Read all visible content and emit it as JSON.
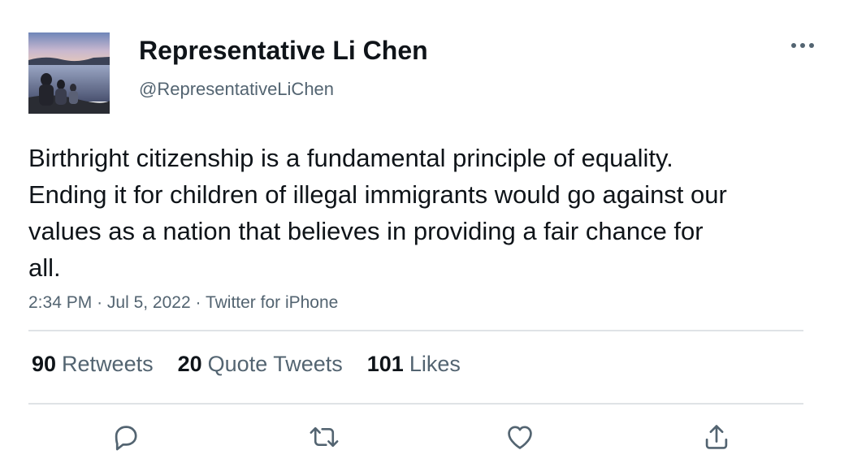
{
  "user": {
    "display_name": "Representative Li Chen",
    "handle": "@RepresentativeLiChen",
    "avatar_icon": "profile-photo-lake-sunset"
  },
  "tweet": {
    "text": "Birthright citizenship is a fundamental principle of equality. Ending it for children of illegal immigrants would go against our values as a nation that believes in providing a fair chance for all.",
    "time": "2:34 PM",
    "date": "Jul 5, 2022",
    "source": "Twitter for iPhone",
    "separator": "·"
  },
  "stats": {
    "retweets_count": "90",
    "retweets_label": "Retweets",
    "quotes_count": "20",
    "quotes_label": "Quote Tweets",
    "likes_count": "101",
    "likes_label": "Likes"
  },
  "actions": {
    "reply_icon": "reply-icon",
    "retweet_icon": "retweet-icon",
    "like_icon": "heart-icon",
    "share_icon": "share-icon",
    "more_icon": "more-horizontal-icon"
  },
  "colors": {
    "text": "#0f1419",
    "secondary": "#536471",
    "divider": "#dfe3e6"
  }
}
